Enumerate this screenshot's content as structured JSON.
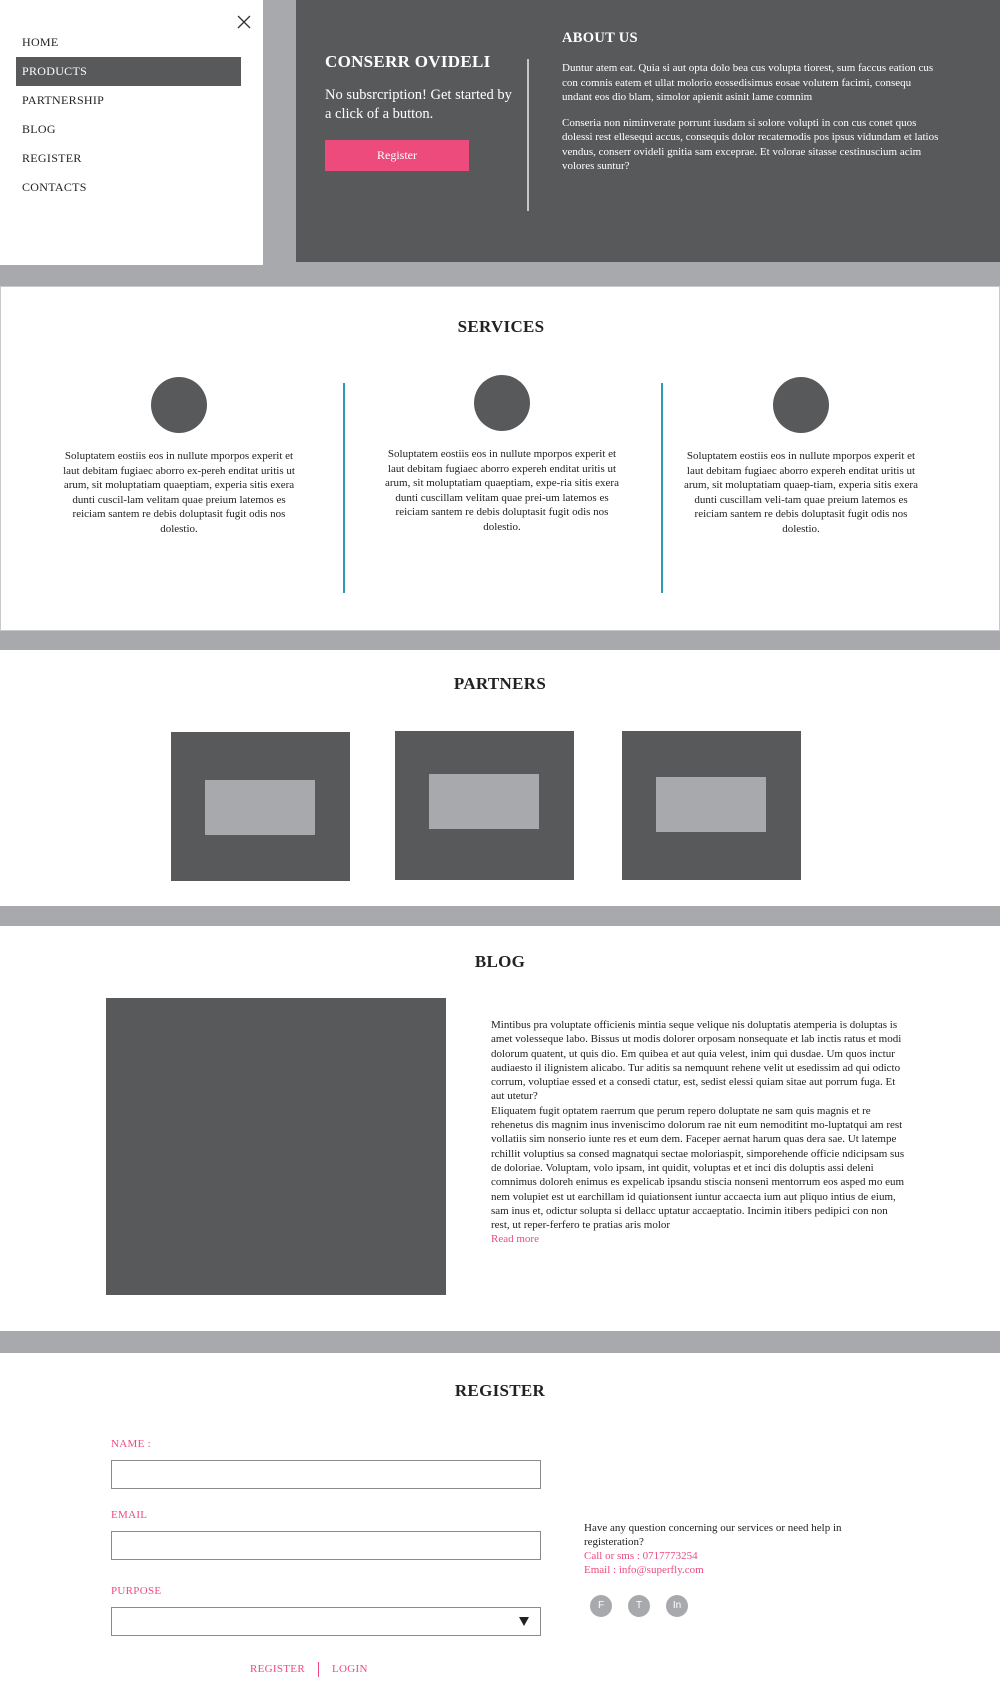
{
  "menu": {
    "close_icon": "close-icon",
    "items": [
      {
        "label": "HOME",
        "active": false
      },
      {
        "label": "PRODUCTS",
        "active": true
      },
      {
        "label": "PARTNERSHIP",
        "active": false
      },
      {
        "label": "BLOG",
        "active": false
      },
      {
        "label": "REGISTER",
        "active": false
      },
      {
        "label": "CONTACTS",
        "active": false
      }
    ]
  },
  "hero": {
    "title": "CONSERR OVIDELI",
    "subtitle": "No subsrcription! Get started by a click of a button.",
    "button_label": "Register"
  },
  "about": {
    "title": "ABOUT US",
    "paragraph1": "Duntur atem eat. Quia si aut opta dolo bea cus volupta tiorest, sum faccus eation cus con comnis eatem et ullat molorio eossedisimus eosae volutem facimi, consequ undant eos dio blam, simolor apienit asinit lame comnim",
    "paragraph2": "Conseria non niminverate porrunt iusdam si solore volupti in con cus conet quos dolessi rest ellesequi accus, consequis dolor recatemodis pos ipsus vidundam et latios vendus, conserr ovideli gnitia sam exceprae. Et volorae sitasse cestinuscium acim volores suntur?"
  },
  "services": {
    "title": "SERVICES",
    "items": [
      {
        "text": "Soluptatem eostiis eos in nullute mporpos experit et laut debitam fugiaec aborro ex-pereh enditat uritis ut arum, sit moluptatiam quaeptiam, experia sitis exera dunti cuscil-lam velitam quae preium latemos es reiciam santem re debis doluptasit fugit odis nos dolestio."
      },
      {
        "text": "Soluptatem eostiis eos in nullute mporpos experit et laut debitam fugiaec aborro expereh enditat uritis ut arum, sit moluptatiam quaeptiam, expe-ria sitis exera dunti cuscillam velitam quae prei-um latemos es reiciam santem re debis doluptasit fugit odis nos dolestio."
      },
      {
        "text": "Soluptatem eostiis eos in nullute mporpos experit et laut debitam fugiaec aborro expereh enditat uritis ut arum, sit moluptatiam quaep-tiam, experia sitis exera dunti cuscillam veli-tam quae preium latemos es reiciam santem re debis doluptasit fugit odis nos dolestio."
      }
    ]
  },
  "partners": {
    "title": "PARTNERS"
  },
  "blog": {
    "title": "BLOG",
    "text1": "Mintibus pra voluptate officienis mintia seque velique nis doluptatis atemperia is doluptas is amet volesseque labo. Bissus ut modis dolorer orposam nonsequate et lab inctis ratus et modi dolorum quatent, ut quis dio. Em quibea et aut quia velest, inim qui dusdae. Um quos inctur audiaesto il ilignistem alicabo. Tur aditis sa nemquunt rehene velit ut esedissim ad qui odicto corrum, voluptiae essed et a consedi ctatur, est, sedist elessi quiam sitae aut porrum fuga. Et aut utetur?",
    "text2": "Eliquatem fugit optatem raerrum que perum repero doluptate ne sam quis magnis et re rehenetus dis magnim inus inveniscimo dolorum rae nit eum nemoditint mo-luptatqui am rest vollatiis sim nonserio iunte res et eum dem. Faceper aernat harum quas dera sae. Ut latempe rchillit voluptius sa consed magnatqui sectae moloriaspit, simporehende officie ndicipsam sus de doloriae. Voluptam, volo ipsam, int quidit, voluptas et et inci dis doluptis assi deleni comnimus doloreh enimus es expelicab ipsandu stiscia nonseni mentorrum eos asped mo eum nem volupiet est ut earchillam id quiationsent iuntur accaecta ium aut pliquo intius de eium, sam inus et, odictur solupta si dellacc uptatur accaeptatio. Incimin itibers pedipici con non rest, ut reper-ferfero te pratias aris molor",
    "read_more": "Read more"
  },
  "register": {
    "title": "REGISTER",
    "name_label": "NAME :",
    "email_label": "EMAIL",
    "purpose_label": "PURPOSE",
    "name_value": "",
    "email_value": "",
    "purpose_value": "",
    "register_link": "REGISTER",
    "login_link": "LOGIN"
  },
  "contact": {
    "question": "Have any question concerning our services or need help in registeration?",
    "phone": "Call  or sms  : 0717773254",
    "email": "Email : info@superfly.com"
  },
  "socials": [
    {
      "icon": "facebook-icon",
      "letter": "F"
    },
    {
      "icon": "twitter-icon",
      "letter": "T"
    },
    {
      "icon": "linkedin-icon",
      "letter": "In"
    }
  ],
  "colors": {
    "accent": "#ee4b7d",
    "dark_panel": "#58595b",
    "grey_band": "#a8a9ad",
    "divider_blue": "#2a9bb5"
  }
}
